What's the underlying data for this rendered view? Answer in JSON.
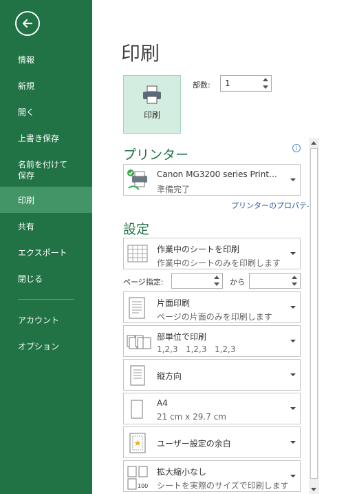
{
  "sidebar": {
    "items": [
      {
        "label": "情報"
      },
      {
        "label": "新規"
      },
      {
        "label": "開く"
      },
      {
        "label": "上書き保存"
      },
      {
        "label": "名前を付けて\n保存"
      },
      {
        "label": "印刷",
        "active": true
      },
      {
        "label": "共有"
      },
      {
        "label": "エクスポート"
      },
      {
        "label": "閉じる"
      },
      {
        "label": "アカウント"
      },
      {
        "label": "オプション"
      }
    ]
  },
  "main": {
    "title": "印刷",
    "print_button": "印刷",
    "copies": {
      "label": "部数:",
      "value": "1"
    },
    "printer": {
      "heading": "プリンター",
      "name": "Canon MG3200 series Print…",
      "status": "準備完了",
      "properties_link": "プリンターのプロパティ"
    },
    "settings": {
      "heading": "設定",
      "scope": {
        "title": "作業中のシートを印刷",
        "desc": "作業中のシートのみを印刷します"
      },
      "pages": {
        "label": "ページ指定:",
        "to": "から",
        "from_value": "",
        "to_value": ""
      },
      "sides": {
        "title": "片面印刷",
        "desc": "ページの片面のみを印刷します"
      },
      "collate": {
        "title": "部単位で印刷",
        "desc": "1,2,3   1,2,3   1,2,3"
      },
      "orientation": {
        "title": "縦方向"
      },
      "paper": {
        "title": "A4",
        "desc": "21 cm x 29.7 cm"
      },
      "margins": {
        "title": "ユーザー設定の余白"
      },
      "scaling": {
        "title": "拡大縮小なし",
        "desc": "シートを実際のサイズで印刷します"
      }
    }
  },
  "colors": {
    "sidebar": "#217346",
    "active": "#439467",
    "accent": "#217346",
    "link": "#2a5a9a"
  }
}
